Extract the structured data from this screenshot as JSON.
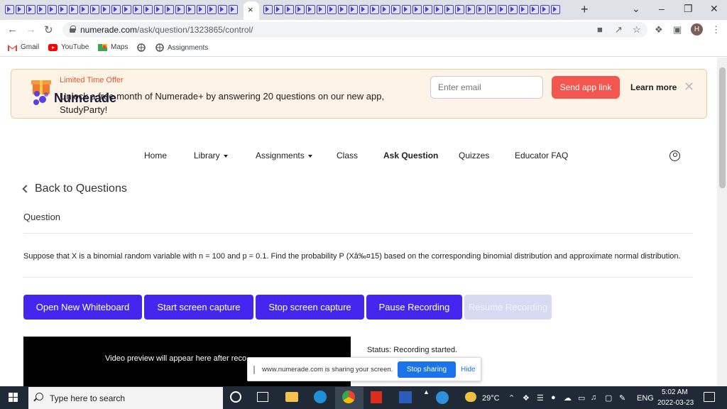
{
  "browser": {
    "tab_close": "×",
    "new_tab": "+",
    "window_controls": [
      "⌄",
      "–",
      "❐",
      "✕"
    ],
    "url_domain": "numerade.com",
    "url_path": "/ask/question/1323865/control/",
    "profile_initial": "H",
    "bookmarks": [
      "Gmail",
      "YouTube",
      "Maps",
      "",
      "Assignments"
    ]
  },
  "promo": {
    "title": "Limited Time Offer",
    "text": "Unlock a free month of Numerade+ by answering 20 questions on our new app, StudyParty!",
    "email_placeholder": "Enter email",
    "send_label": "Send app link",
    "learn_label": "Learn more",
    "close": "✕"
  },
  "site": {
    "logo": "Numerade",
    "nav": [
      "Home",
      "Library",
      "Assignments",
      "Class",
      "Ask Question",
      "Quizzes",
      "Educator FAQ"
    ]
  },
  "main": {
    "back_label": "Back to Questions",
    "question_label": "Question",
    "question_text": "Suppose that X is a binomial random variable with n = 100 and p = 0.1. Find the probability P (Xâ‰¤15) based on the corresponding binomial distribution and approximate normal distribution.",
    "buttons": [
      "Open New Whiteboard",
      "Start screen capture",
      "Stop screen capture",
      "Pause Recording",
      "Resume Recording"
    ],
    "video_text": "Video preview will appear here after reco",
    "status": "Status: Recording started."
  },
  "sharebar": {
    "text": "www.numerade.com is sharing your screen.",
    "stop_label": "Stop sharing",
    "hide_label": "Hide"
  },
  "taskbar": {
    "search_placeholder": "Type here to search",
    "temperature": "29°C",
    "language": "ENG",
    "time": "5:02 AM",
    "date": "2022-03-23"
  },
  "colors": {
    "primary": "#4526ef",
    "send": "#f2564e",
    "offer": "#e4572e"
  }
}
